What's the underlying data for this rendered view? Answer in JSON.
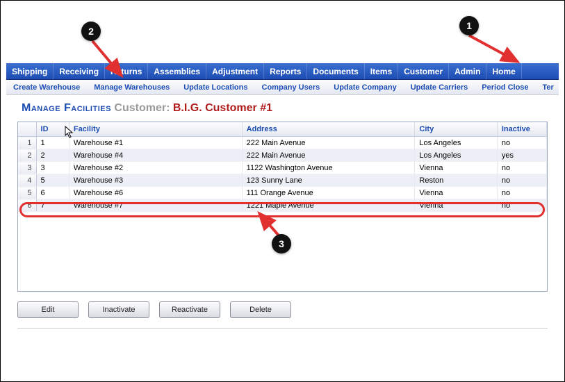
{
  "mainNav": [
    "Shipping",
    "Receiving",
    "Returns",
    "Assemblies",
    "Adjustment",
    "Reports",
    "Documents",
    "Items",
    "Customer",
    "Admin",
    "Home"
  ],
  "subNav": [
    "Create Warehouse",
    "Manage Warehouses",
    "Update Locations",
    "Company Users",
    "Update Company",
    "Update Carriers",
    "Period Close",
    "Ter"
  ],
  "title": {
    "section": "Manage Facilities",
    "label": "Customer:",
    "customer": "B.I.G. Customer #1"
  },
  "columns": [
    "",
    "ID",
    "Facility",
    "Address",
    "City",
    "Inactive"
  ],
  "rows": [
    {
      "n": "1",
      "id": "1",
      "facility": "Warehouse #1",
      "address": "222 Main Avenue",
      "city": "Los Angeles",
      "inactive": "no"
    },
    {
      "n": "2",
      "id": "2",
      "facility": "Warehouse #4",
      "address": "222 Main Avenue",
      "city": "Los Angeles",
      "inactive": "yes"
    },
    {
      "n": "3",
      "id": "3",
      "facility": "Warehouse #2",
      "address": "1122 Washington Avenue",
      "city": "Vienna",
      "inactive": "no"
    },
    {
      "n": "4",
      "id": "5",
      "facility": "Warehouse #3",
      "address": "123 Sunny Lane",
      "city": "Reston",
      "inactive": "no"
    },
    {
      "n": "5",
      "id": "6",
      "facility": "Warehouse #6",
      "address": "111 Orange Avenue",
      "city": "Vienna",
      "inactive": "no"
    },
    {
      "n": "6",
      "id": "7",
      "facility": "Warehouse #7",
      "address": "1221 Maple Avenue",
      "city": "Vienna",
      "inactive": "no"
    }
  ],
  "buttons": {
    "edit": "Edit",
    "inactivate": "Inactivate",
    "reactivate": "Reactivate",
    "delete": "Delete"
  },
  "callouts": {
    "c1": "1",
    "c2": "2",
    "c3": "3"
  }
}
